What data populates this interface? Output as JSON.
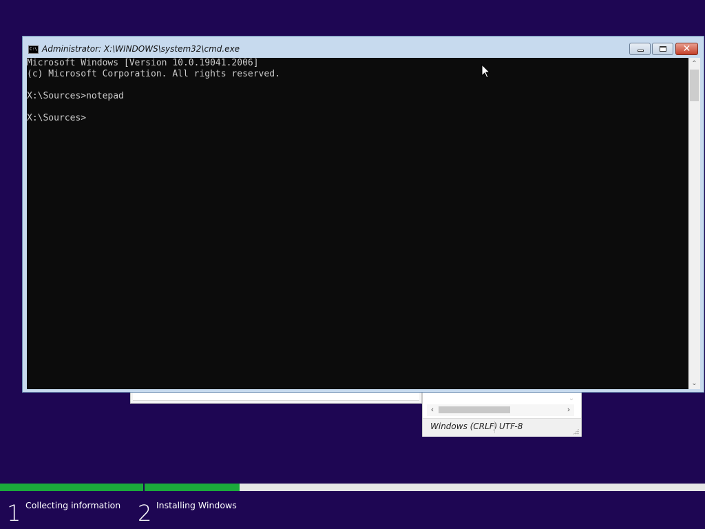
{
  "cmd_window": {
    "title": "Administrator: X:\\WINDOWS\\system32\\cmd.exe",
    "icon": "console-icon",
    "controls": {
      "minimize": "minimize-icon",
      "maximize": "maximize-icon",
      "close_glyph": "✕"
    },
    "console_lines": [
      "Microsoft Windows [Version 10.0.19041.2006]",
      "(c) Microsoft Corporation. All rights reserved.",
      "",
      "X:\\Sources>notepad",
      "",
      "X:\\Sources>"
    ],
    "colors": {
      "console_bg": "#0c0c0c",
      "console_text": "#cccccc",
      "frame": "#c7daee"
    }
  },
  "notepad": {
    "status_line_ending": "Windows (CRLF)",
    "status_encoding": "UTF-8"
  },
  "setup": {
    "steps": [
      {
        "number": "1",
        "label": "Collecting information",
        "progress": 1.0
      },
      {
        "number": "2",
        "label": "Installing Windows",
        "progress": 0.17
      }
    ],
    "colors": {
      "background": "#1e0653",
      "progress_fill": "#1ba93b",
      "progress_track": "#e6e6e6"
    }
  }
}
